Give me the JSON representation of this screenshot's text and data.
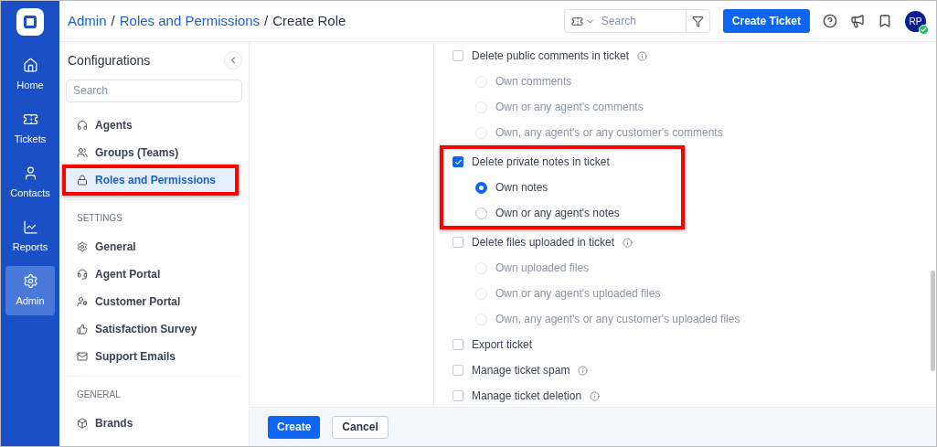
{
  "nav": [
    {
      "label": "Home",
      "selected": false
    },
    {
      "label": "Tickets",
      "selected": false
    },
    {
      "label": "Contacts",
      "selected": false
    },
    {
      "label": "Reports",
      "selected": false
    },
    {
      "label": "Admin",
      "selected": true
    }
  ],
  "breadcrumb": {
    "links": [
      "Admin",
      "Roles and Permissions"
    ],
    "separator": "/",
    "current": "Create Role"
  },
  "header": {
    "search_placeholder": "Search",
    "create_button": "Create Ticket",
    "avatar": "RP",
    "online": true
  },
  "sidebar": {
    "title": "Configurations",
    "search_placeholder": "Search",
    "sections": [
      {
        "items": [
          {
            "label": "Agents",
            "selected": false,
            "highlighted": false
          },
          {
            "label": "Groups (Teams)",
            "selected": false,
            "highlighted": false
          },
          {
            "label": "Roles and Permissions",
            "selected": true,
            "highlighted": true
          }
        ]
      },
      {
        "heading": "SETTINGS",
        "items": [
          {
            "label": "General",
            "selected": false,
            "highlighted": false
          },
          {
            "label": "Agent Portal",
            "selected": false,
            "highlighted": false
          },
          {
            "label": "Customer Portal",
            "selected": false,
            "highlighted": false
          },
          {
            "label": "Satisfaction Survey",
            "selected": false,
            "highlighted": false
          },
          {
            "label": "Support Emails",
            "selected": false,
            "highlighted": false
          }
        ]
      },
      {
        "heading": "GENERAL",
        "items": [
          {
            "label": "Brands",
            "selected": false,
            "highlighted": false
          }
        ]
      }
    ]
  },
  "permissions": [
    {
      "label": "Delete public comments in ticket",
      "checked": false,
      "info": true,
      "highlighted": false,
      "options": [
        {
          "label": "Own comments",
          "selected": false
        },
        {
          "label": "Own or any agent's comments",
          "selected": false
        },
        {
          "label": "Own, any agent's or any customer's comments",
          "selected": false
        }
      ]
    },
    {
      "label": "Delete private notes in ticket",
      "checked": true,
      "info": false,
      "highlighted": true,
      "options": [
        {
          "label": "Own notes",
          "selected": true
        },
        {
          "label": "Own or any agent's notes",
          "selected": false
        }
      ]
    },
    {
      "label": "Delete files uploaded in ticket",
      "checked": false,
      "info": true,
      "highlighted": false,
      "options": [
        {
          "label": "Own uploaded files",
          "selected": false
        },
        {
          "label": "Own or any agent's uploaded files",
          "selected": false
        },
        {
          "label": "Own, any agent's or any customer's uploaded files",
          "selected": false
        }
      ]
    },
    {
      "label": "Export ticket",
      "checked": false,
      "info": false,
      "highlighted": false
    },
    {
      "label": "Manage ticket spam",
      "checked": false,
      "info": true,
      "highlighted": false
    },
    {
      "label": "Manage ticket deletion",
      "checked": false,
      "info": true,
      "highlighted": false
    }
  ],
  "footer": {
    "primary": "Create",
    "secondary": "Cancel"
  }
}
